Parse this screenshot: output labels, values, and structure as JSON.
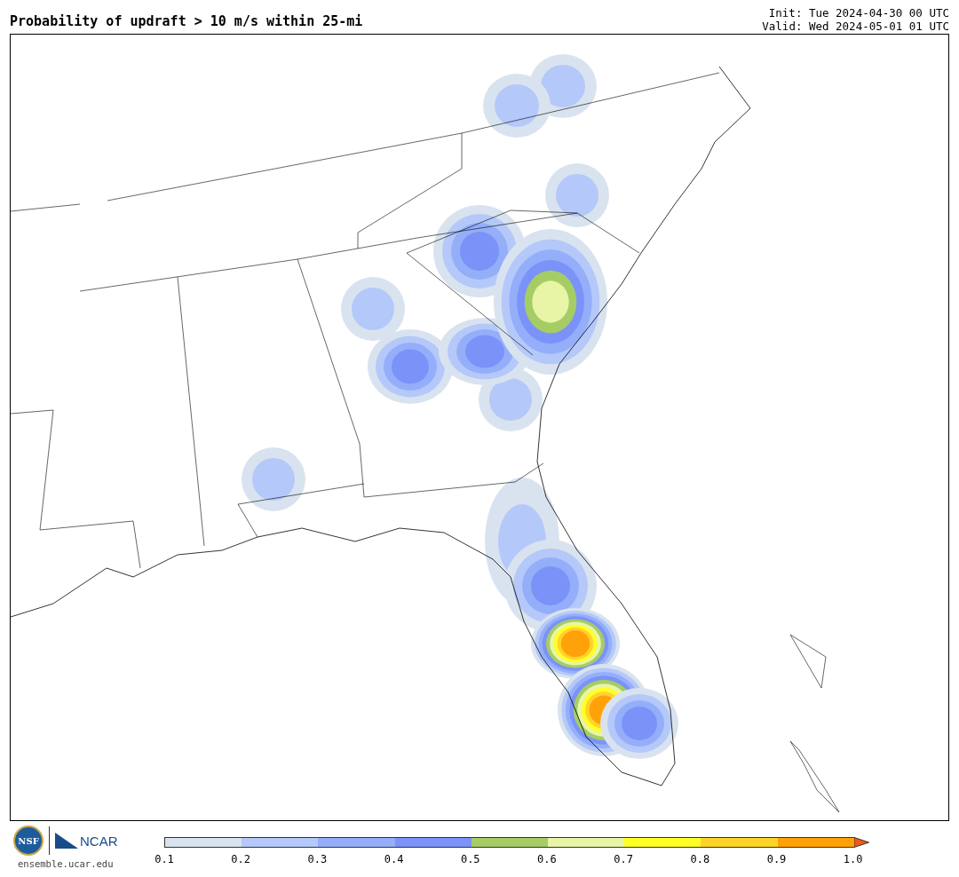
{
  "title": "Probability of updraft > 10 m/s within 25-mi",
  "init": "Init: Tue 2024-04-30 00 UTC",
  "valid": "Valid: Wed 2024-05-01 01 UTC",
  "logos": {
    "nsf": "NSF",
    "ncar": "NCAR",
    "site": "ensemble.ucar.edu"
  },
  "colorbar": {
    "bins": [
      {
        "color": "#d9e3ef"
      },
      {
        "color": "#b4c8fa"
      },
      {
        "color": "#94aefa"
      },
      {
        "color": "#7b92f8"
      },
      {
        "color": "#a6cc66"
      },
      {
        "color": "#e8f5a6"
      },
      {
        "color": "#ffff26"
      },
      {
        "color": "#ffd42a"
      },
      {
        "color": "#ffa20a"
      },
      {
        "kind": "arrow",
        "color": "#f05a14"
      }
    ],
    "ticks": [
      "0.1",
      "0.2",
      "0.3",
      "0.4",
      "0.5",
      "0.6",
      "0.7",
      "0.8",
      "0.9",
      "1.0"
    ]
  }
}
